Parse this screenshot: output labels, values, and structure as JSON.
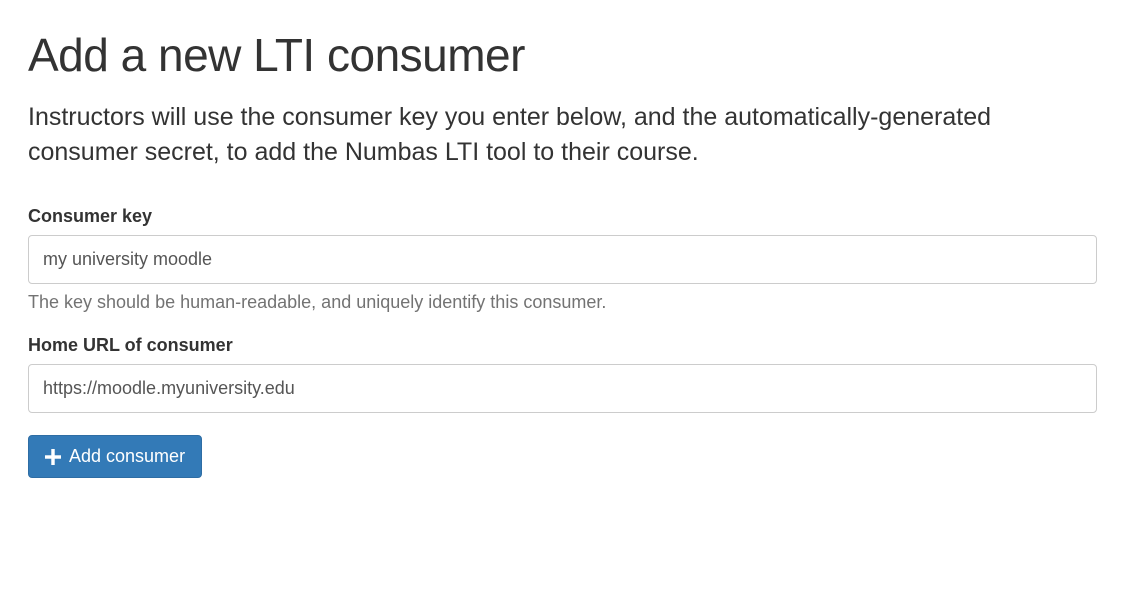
{
  "page": {
    "title": "Add a new LTI consumer",
    "lead": "Instructors will use the consumer key you enter below, and the automatically-generated consumer secret, to add the Numbas LTI tool to their course."
  },
  "form": {
    "consumer_key": {
      "label": "Consumer key",
      "value": "my university moodle",
      "help": "The key should be human-readable, and uniquely identify this consumer."
    },
    "home_url": {
      "label": "Home URL of consumer",
      "value": "https://moodle.myuniversity.edu"
    },
    "submit_label": "Add consumer"
  }
}
